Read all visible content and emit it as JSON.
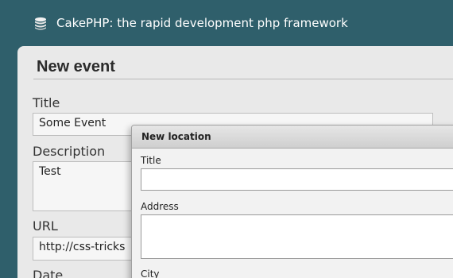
{
  "header": {
    "logo_icon": "database-stack-icon",
    "title": "CakePHP: the rapid development php framework"
  },
  "form": {
    "heading": "New event",
    "title_label": "Title",
    "title_value": "Some Event",
    "description_label": "Description",
    "description_value": "Test",
    "url_label": "URL",
    "url_value": "http://css-tricks",
    "date_label": "Date"
  },
  "dialog": {
    "title": "New location",
    "title_label": "Title",
    "title_value": "",
    "address_label": "Address",
    "address_value": "",
    "city_label": "City"
  },
  "colors": {
    "background": "#2f5f6b",
    "panel": "#e9e9e9",
    "dialog_header": "#d6d6d6"
  }
}
